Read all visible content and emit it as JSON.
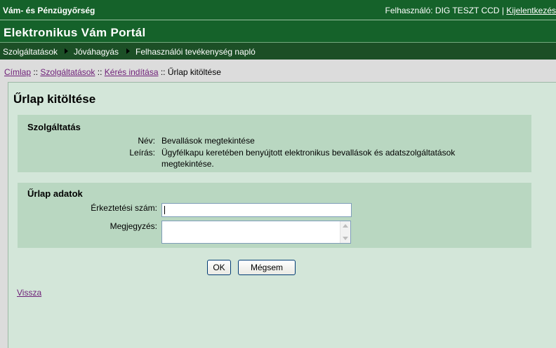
{
  "header": {
    "org": "Vám- és Pénzügyőrség",
    "user_prefix": "Felhasználó: DIG TESZT CCD",
    "separator": "|",
    "logout": "Kijelentkezés"
  },
  "portal_title": "Elektronikus Vám Portál",
  "menu": [
    {
      "label": "Szolgáltatások"
    },
    {
      "label": "Jóváhagyás"
    },
    {
      "label": "Felhasználói tevékenység napló"
    }
  ],
  "breadcrumb": {
    "items": [
      "Címlap",
      "Szolgáltatások",
      "Kérés indítása"
    ],
    "separator": "::",
    "current": "Űrlap kitöltése"
  },
  "page_title": "Űrlap kitöltése",
  "service": {
    "heading": "Szolgáltatás",
    "name_label": "Név:",
    "name_value": "Bevallások megtekintése",
    "desc_label": "Leírás:",
    "desc_value_line1": "Ügyfélkapu keretében benyújtott elektronikus bevallások és adatszolgáltatások",
    "desc_value_line2": "megtekintése."
  },
  "form": {
    "heading": "Űrlap adatok",
    "arrival_label": "Érkeztetési szám:",
    "arrival_value": "",
    "note_label": "Megjegyzés:",
    "note_value": ""
  },
  "buttons": {
    "ok": "OK",
    "cancel": "Mégsem"
  },
  "back_link": "Vissza",
  "colors": {
    "header_green": "#15622a",
    "menu_green": "#1c4f26",
    "content_bg": "#d3e6d9",
    "panel_bg": "#b9d7c1",
    "link": "#6e1f78"
  },
  "icons": {
    "menu_separator": "triangle-right-icon"
  }
}
